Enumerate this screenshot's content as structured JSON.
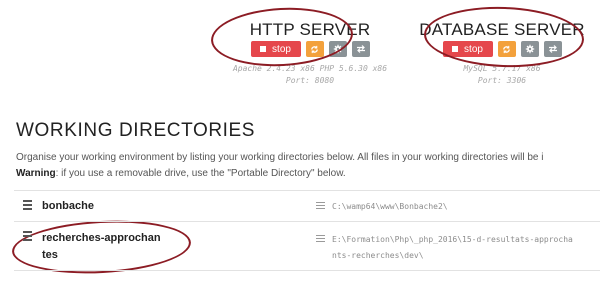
{
  "http_server": {
    "title": "HTTP SERVER",
    "stop_label": "stop",
    "versions": "Apache 2.4.23 x86  PHP 5.6.30 x86",
    "port": "Port: 8080"
  },
  "database_server": {
    "title": "DATABASE SERVER",
    "stop_label": "stop",
    "versions": "MySQL 5.7.17 x86",
    "port": "Port: 3306"
  },
  "working_directories": {
    "title": "WORKING DIRECTORIES",
    "description": "Organise your working environment by listing your working directories below. All files in your working directories will be i",
    "warning_label": "Warning",
    "warning_text": ": if you use a removable drive, use the \"Portable Directory\" below.",
    "rows": [
      {
        "name": "bonbache",
        "path": "C:\\wamp64\\www\\Bonbache2\\"
      },
      {
        "name_line1": "recherches-approchan",
        "name_line2": "tes",
        "path_line1": "E:\\Formation\\Php\\_php_2016\\15-d-resultats-approcha",
        "path_line2": "nts-recherches\\dev\\"
      }
    ]
  },
  "colors": {
    "stop": "#e5474c",
    "restart": "#f3a13c",
    "settings": "#8a9296",
    "annotation": "#8c1c24"
  },
  "icons": [
    "stop-square-icon",
    "refresh-icon",
    "gear-icon",
    "swap-icon",
    "hamburger-icon",
    "list-icon"
  ]
}
